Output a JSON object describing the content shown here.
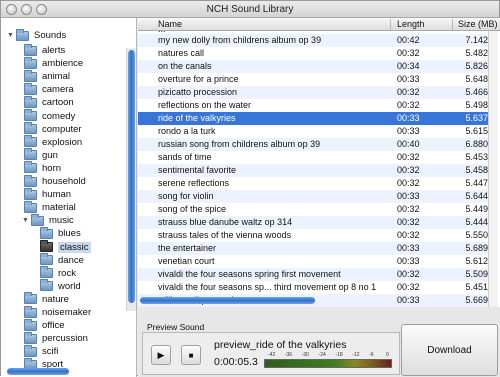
{
  "window": {
    "title": "NCH Sound Library"
  },
  "sidebar": {
    "root": "Sounds",
    "items": [
      {
        "label": "alerts"
      },
      {
        "label": "ambience"
      },
      {
        "label": "animal"
      },
      {
        "label": "camera"
      },
      {
        "label": "cartoon"
      },
      {
        "label": "comedy"
      },
      {
        "label": "computer"
      },
      {
        "label": "explosion"
      },
      {
        "label": "gun"
      },
      {
        "label": "horn"
      },
      {
        "label": "household"
      },
      {
        "label": "human"
      },
      {
        "label": "material"
      },
      {
        "label": "music"
      },
      {
        "label": "blues"
      },
      {
        "label": "classic"
      },
      {
        "label": "dance"
      },
      {
        "label": "rock"
      },
      {
        "label": "world"
      },
      {
        "label": "nature"
      },
      {
        "label": "noisemaker"
      },
      {
        "label": "office"
      },
      {
        "label": "percussion"
      },
      {
        "label": "scifi"
      },
      {
        "label": "sport"
      }
    ],
    "selected": "classic"
  },
  "table": {
    "columns": {
      "name": "Name",
      "length": "Length",
      "size": "Size (MB)"
    },
    "partial_row": "...",
    "rows": [
      {
        "name": "my new dolly from childrens album op 39",
        "length": "00:42",
        "size": "7.142"
      },
      {
        "name": "natures call",
        "length": "00:32",
        "size": "5.482"
      },
      {
        "name": "on the canals",
        "length": "00:34",
        "size": "5.826"
      },
      {
        "name": "overture for a prince",
        "length": "00:33",
        "size": "5.648"
      },
      {
        "name": "pizicatto procession",
        "length": "00:32",
        "size": "5.466"
      },
      {
        "name": "reflections on the water",
        "length": "00:32",
        "size": "5.498"
      },
      {
        "name": "ride of the valkyries",
        "length": "00:33",
        "size": "5.637"
      },
      {
        "name": "rondo a la turk",
        "length": "00:33",
        "size": "5.615"
      },
      {
        "name": "russian song from childrens album op 39",
        "length": "00:40",
        "size": "6.880"
      },
      {
        "name": "sands of time",
        "length": "00:32",
        "size": "5.453"
      },
      {
        "name": "sentimental favorite",
        "length": "00:32",
        "size": "5.458"
      },
      {
        "name": "serene reflections",
        "length": "00:32",
        "size": "5.447"
      },
      {
        "name": "song for violin",
        "length": "00:33",
        "size": "5.644"
      },
      {
        "name": "song of the spice",
        "length": "00:32",
        "size": "5.449"
      },
      {
        "name": "strauss blue danube waltz op 314",
        "length": "00:32",
        "size": "5.444"
      },
      {
        "name": "strauss tales of the vienna woods",
        "length": "00:32",
        "size": "5.550"
      },
      {
        "name": "the entertainer",
        "length": "00:33",
        "size": "5.689"
      },
      {
        "name": "venetian court",
        "length": "00:33",
        "size": "5.612"
      },
      {
        "name": "vivaldi the four seasons spring first movement",
        "length": "00:32",
        "size": "5.509"
      },
      {
        "name": "vivaldi the four seasons sp... third movement op 8 no 1",
        "length": "00:32",
        "size": "5.451"
      },
      {
        "name": "william tell pastoral",
        "length": "00:33",
        "size": "5.669"
      }
    ],
    "selected": "ride of the valkyries"
  },
  "preview": {
    "label": "Preview Sound",
    "play_symbol": "▶",
    "stop_symbol": "■",
    "filename": "preview_ride of the valkyries",
    "time": "0:00:05.3",
    "meter_labels": [
      "-42",
      "-36",
      "-30",
      "-24",
      "-18",
      "-12",
      "-6",
      "0"
    ]
  },
  "download": {
    "label": "Download"
  },
  "colors": {
    "selection": "#3875d7",
    "alt_row": "#edf3fe",
    "scroll_thumb": "#2f6fcf",
    "tree_selection": "#c9d8ec"
  },
  "icons": {
    "folder": "folder-icon",
    "play": "play-icon",
    "stop": "stop-icon"
  }
}
